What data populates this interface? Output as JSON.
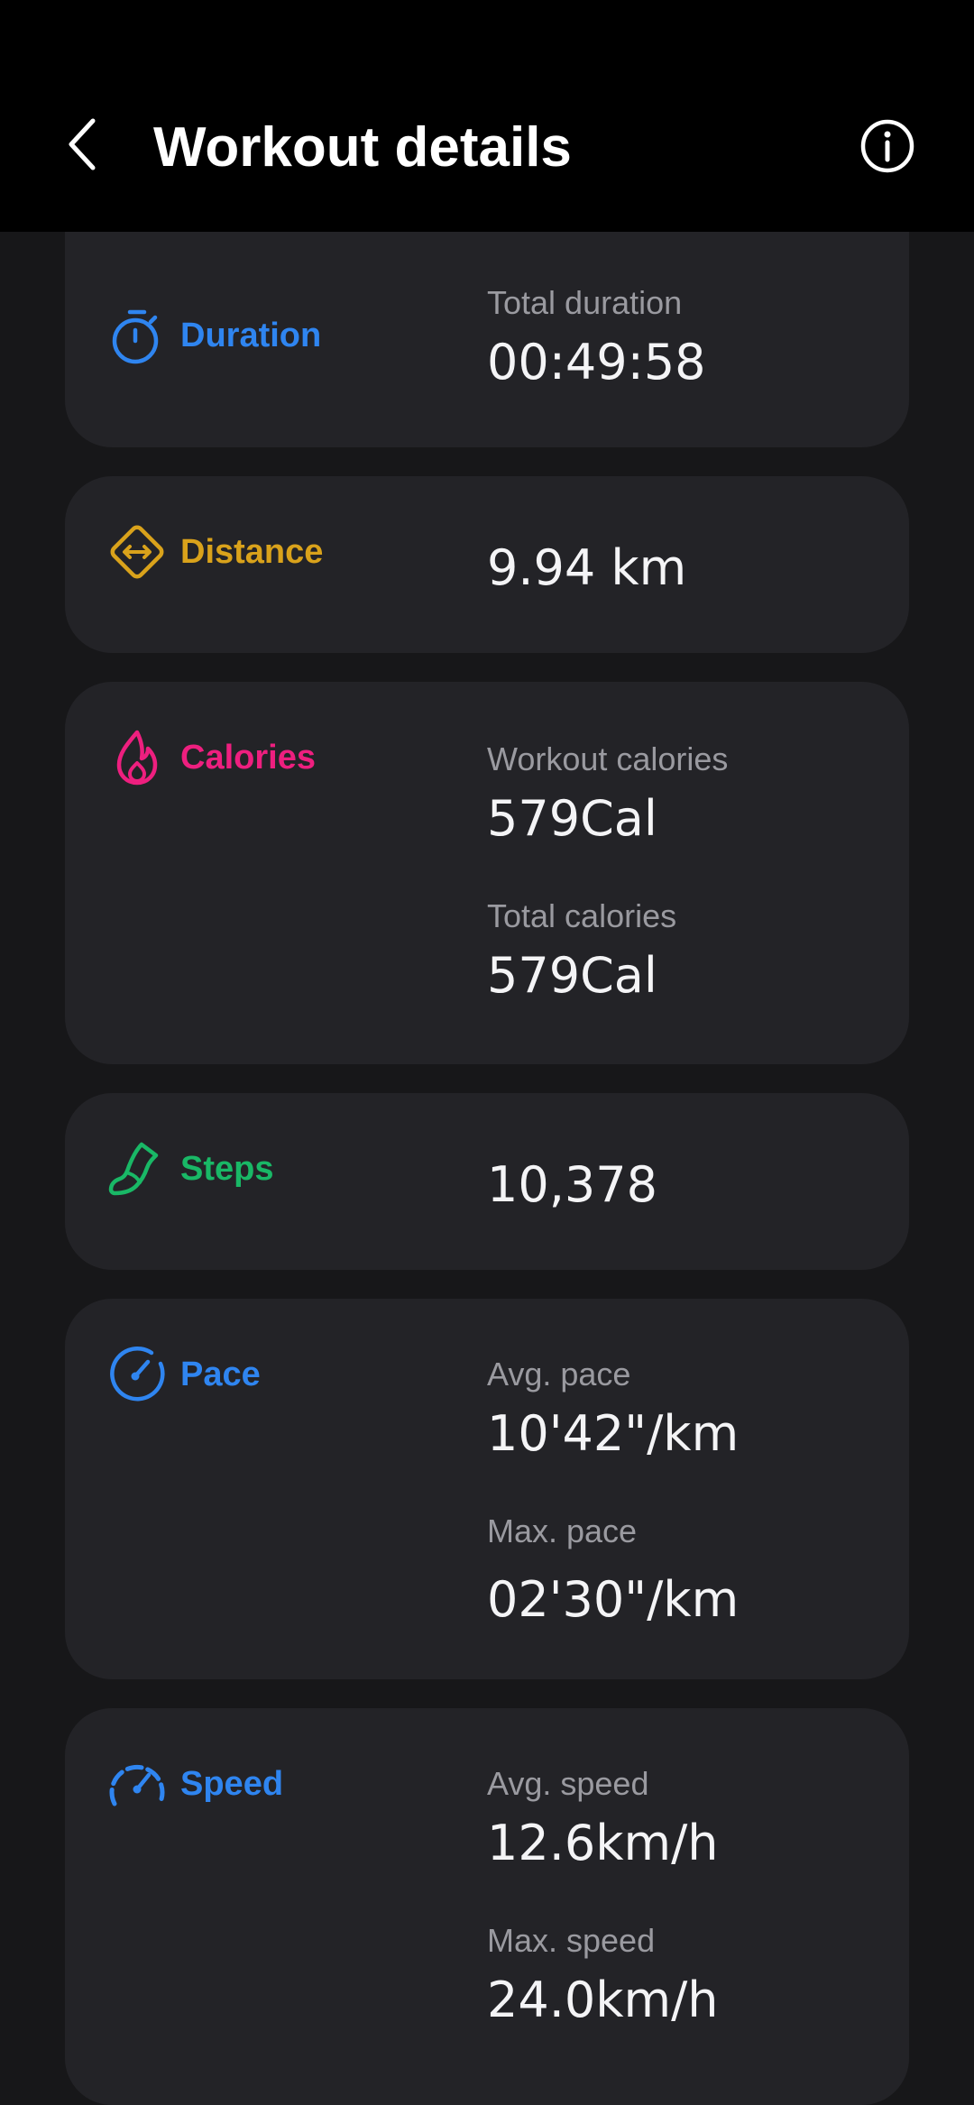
{
  "header": {
    "title": "Workout details"
  },
  "colors": {
    "duration": "#2f85f0",
    "distance": "#d9a21b",
    "calories": "#ee1f7f",
    "steps": "#19b866",
    "pace": "#2f85f0",
    "speed": "#2f85f0"
  },
  "icons": {
    "back": "chevron-left-icon",
    "info": "info-circle-icon",
    "duration": "stopwatch-icon",
    "distance": "distance-diamond-icon",
    "calories": "flame-icon",
    "steps": "shoe-icon",
    "pace": "gauge-icon",
    "speed": "speedometer-icon"
  },
  "cards": {
    "duration": {
      "label": "Duration",
      "total_label": "Total duration",
      "total_value": "00:49:58"
    },
    "distance": {
      "label": "Distance",
      "value": "9.94 km"
    },
    "calories": {
      "label": "Calories",
      "workout_label": "Workout calories",
      "workout_value": "579Cal",
      "total_label": "Total calories",
      "total_value": "579Cal"
    },
    "steps": {
      "label": "Steps",
      "value": "10,378"
    },
    "pace": {
      "label": "Pace",
      "avg_label": "Avg. pace",
      "avg_value": "10'42\"/km",
      "max_label": "Max. pace",
      "max_value": "02'30\"/km"
    },
    "speed": {
      "label": "Speed",
      "avg_label": "Avg. speed",
      "avg_value": "12.6km/h",
      "max_label": "Max. speed",
      "max_value": "24.0km/h"
    }
  }
}
